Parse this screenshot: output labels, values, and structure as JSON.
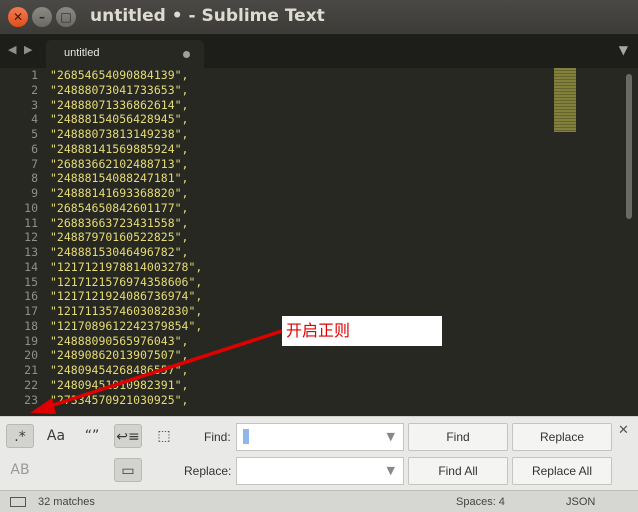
{
  "window": {
    "title": "untitled • - Sublime Text",
    "close_glyph": "✕",
    "minimize_glyph": "–",
    "maximize_glyph": "□"
  },
  "tabs": {
    "nav_glyph": "◀ ▶",
    "active_label": "untitled",
    "dropdown_glyph": "▼"
  },
  "editor": {
    "lines": [
      {
        "n": "1",
        "text": "\"26854654090884139\","
      },
      {
        "n": "2",
        "text": "\"24888073041733653\","
      },
      {
        "n": "3",
        "text": "\"24888071336862614\","
      },
      {
        "n": "4",
        "text": "\"24888154056428945\","
      },
      {
        "n": "5",
        "text": "\"24888073813149238\","
      },
      {
        "n": "6",
        "text": "\"24888141569885924\","
      },
      {
        "n": "7",
        "text": "\"26883662102488713\","
      },
      {
        "n": "8",
        "text": "\"24888154088247181\","
      },
      {
        "n": "9",
        "text": "\"24888141693368820\","
      },
      {
        "n": "10",
        "text": "\"26854650842601177\","
      },
      {
        "n": "11",
        "text": "\"26883663723431558\","
      },
      {
        "n": "12",
        "text": "\"24887970160522825\","
      },
      {
        "n": "13",
        "text": "\"24888153046496782\","
      },
      {
        "n": "14",
        "text": "\"1217121978814003278\","
      },
      {
        "n": "15",
        "text": "\"1217121576974358606\","
      },
      {
        "n": "16",
        "text": "\"1217121924086736974\","
      },
      {
        "n": "17",
        "text": "\"1217113574603082830\","
      },
      {
        "n": "18",
        "text": "\"1217089612242379854\","
      },
      {
        "n": "19",
        "text": "\"24888090565976043\","
      },
      {
        "n": "20",
        "text": "\"24890862013907507\","
      },
      {
        "n": "21",
        "text": "\"24809454268486557\","
      },
      {
        "n": "22",
        "text": "\"24809451910982391\","
      },
      {
        "n": "23",
        "text": "\"27334570921030925\","
      }
    ]
  },
  "annotation": {
    "text": "开启正则",
    "color": "#e00000"
  },
  "find_panel": {
    "opt_regex": ".*",
    "opt_case": "Aa",
    "opt_word": "“”",
    "opt_wrap": "↩≡",
    "opt_selection": "⬚",
    "opt_preserve_case": "AB",
    "opt_highlight": "▭",
    "find_label": "Find:",
    "replace_label": "Replace:",
    "find_value": "",
    "replace_value": "",
    "dropdown_glyph": "▼",
    "find_button": "Find",
    "replace_button": "Replace",
    "find_all_button": "Find All",
    "replace_all_button": "Replace All",
    "close_glyph": "✕"
  },
  "status_bar": {
    "matches": "32 matches",
    "spaces": "Spaces: 4",
    "syntax": "JSON"
  },
  "colors": {
    "editor_bg": "#272822",
    "string": "#e6db74",
    "line_number": "#8f908a",
    "arrow": "#e00000"
  }
}
